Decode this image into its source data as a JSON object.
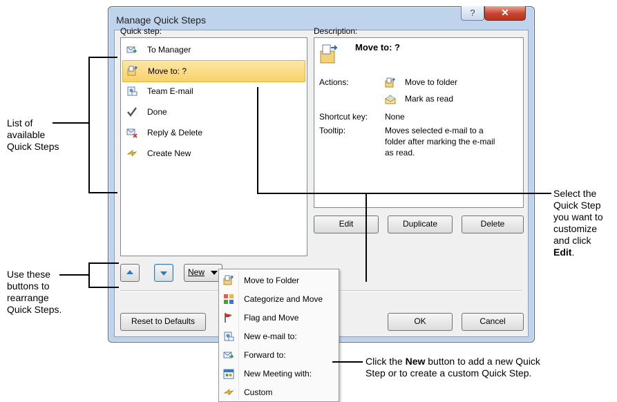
{
  "window": {
    "title": "Manage Quick Steps",
    "help_glyph": "?",
    "close_glyph": "✕"
  },
  "quick_step_label": "Quick step:",
  "description_label": "Description:",
  "quick_steps": [
    {
      "label": "To Manager",
      "icon": "forward-mail-icon"
    },
    {
      "label": "Move to: ?",
      "icon": "move-folder-icon",
      "selected": true
    },
    {
      "label": "Team E-mail",
      "icon": "team-email-icon"
    },
    {
      "label": "Done",
      "icon": "checkmark-icon"
    },
    {
      "label": "Reply & Delete",
      "icon": "reply-delete-icon"
    },
    {
      "label": "Create New",
      "icon": "create-new-icon"
    }
  ],
  "description": {
    "name": "Move to: ?",
    "actions_label": "Actions:",
    "actions": [
      "Move to folder",
      "Mark as read"
    ],
    "shortcut_label": "Shortcut key:",
    "shortcut_value": "None",
    "tooltip_label": "Tooltip:",
    "tooltip_lines": [
      "Moves selected e-mail to a",
      "folder after marking the e-mail",
      "as read."
    ]
  },
  "buttons": {
    "edit": "Edit",
    "duplicate": "Duplicate",
    "delete": "Delete",
    "new": "New",
    "reset": "Reset to Defaults",
    "ok": "OK",
    "cancel": "Cancel"
  },
  "new_menu": [
    {
      "label": "Move to Folder",
      "icon": "move-folder-icon"
    },
    {
      "label": "Categorize and Move",
      "icon": "categorize-icon"
    },
    {
      "label": "Flag and Move",
      "icon": "flag-icon"
    },
    {
      "label": "New e-mail to:",
      "icon": "new-email-icon"
    },
    {
      "label": "Forward to:",
      "icon": "forward-icon"
    },
    {
      "label": "New Meeting with:",
      "icon": "meeting-icon"
    },
    {
      "label": "Custom",
      "icon": "custom-icon"
    }
  ],
  "callouts": {
    "list": [
      "List of",
      "available",
      "Quick Steps"
    ],
    "rearrange": [
      "Use these",
      "buttons to",
      "rearrange",
      "Quick Steps."
    ],
    "select_lines": [
      "Select the",
      "Quick Step",
      "you want to",
      "customize",
      "and click"
    ],
    "select_bold": "Edit",
    "select_tail": ".",
    "new_pre": "Click the ",
    "new_bold": "New",
    "new_post": " button to add a new Quick",
    "new_line2": "Step or to create a custom Quick Step."
  },
  "colors": {
    "selection": "#f8d269",
    "window_frame": "#bfd4ec",
    "close": "#c5432d"
  }
}
